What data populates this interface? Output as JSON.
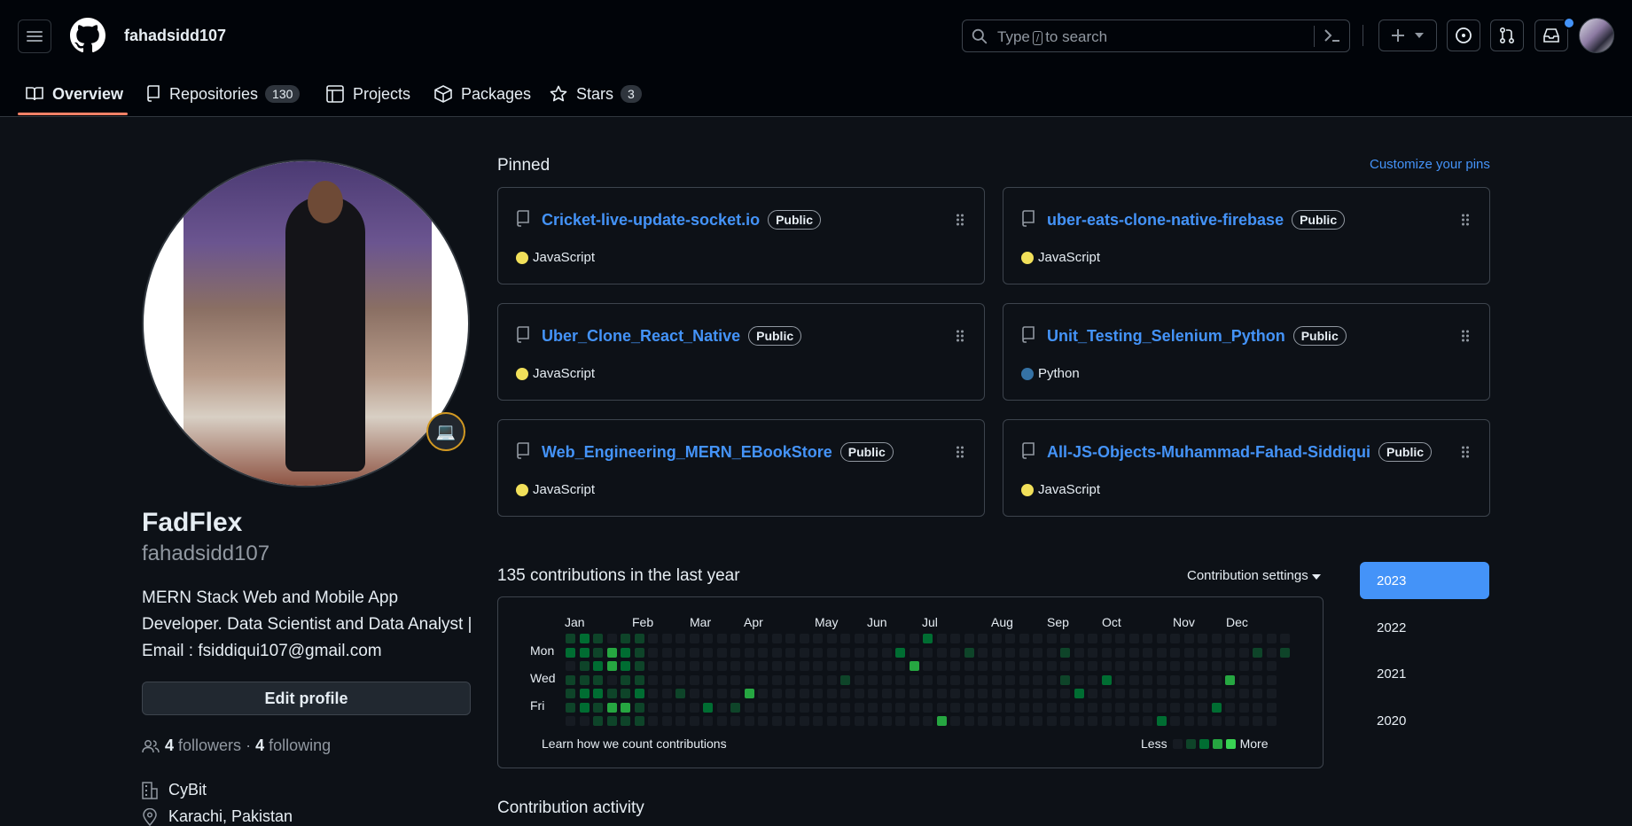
{
  "header": {
    "username": "fahadsidd107",
    "search_placeholder_before": "Type",
    "search_key": "/",
    "search_placeholder_after": "to search"
  },
  "tabs": [
    {
      "label": "Overview",
      "icon": "book-icon"
    },
    {
      "label": "Repositories",
      "count": "130",
      "icon": "repo-icon"
    },
    {
      "label": "Projects",
      "icon": "table-icon"
    },
    {
      "label": "Packages",
      "icon": "package-icon"
    },
    {
      "label": "Stars",
      "count": "3",
      "icon": "star-icon"
    }
  ],
  "profile": {
    "name": "FadFlex",
    "login": "fahadsidd107",
    "bio": "MERN Stack Web and Mobile App Developer. Data Scientist and Data Analyst | Email : fsiddiqui107@gmail.com",
    "edit_label": "Edit profile",
    "followers": "4",
    "followers_label": "followers",
    "following": "4",
    "following_label": "following",
    "separator": "·",
    "company": "CyBit",
    "location": "Karachi, Pakistan",
    "status_emoji": "💻"
  },
  "pinned": {
    "title": "Pinned",
    "customize": "Customize your pins",
    "repos": [
      {
        "name": "Cricket-live-update-socket.io",
        "visibility": "Public",
        "language": "JavaScript",
        "lang_color": "#f1e05a"
      },
      {
        "name": "uber-eats-clone-native-firebase",
        "visibility": "Public",
        "language": "JavaScript",
        "lang_color": "#f1e05a"
      },
      {
        "name": "Uber_Clone_React_Native",
        "visibility": "Public",
        "language": "JavaScript",
        "lang_color": "#f1e05a"
      },
      {
        "name": "Unit_Testing_Selenium_Python",
        "visibility": "Public",
        "language": "Python",
        "lang_color": "#3572A5"
      },
      {
        "name": "Web_Engineering_MERN_EBookStore",
        "visibility": "Public",
        "language": "JavaScript",
        "lang_color": "#f1e05a"
      },
      {
        "name": "All-JS-Objects-Muhammad-Fahad-Siddiqui",
        "visibility": "Public",
        "language": "JavaScript",
        "lang_color": "#f1e05a"
      }
    ]
  },
  "contributions": {
    "title": "135 contributions in the last year",
    "settings_label": "Contribution settings",
    "months": [
      "Jan",
      "Feb",
      "Mar",
      "Apr",
      "May",
      "Jun",
      "Jul",
      "Aug",
      "Sep",
      "Oct",
      "Nov",
      "Dec"
    ],
    "days": [
      "Mon",
      "Wed",
      "Fri"
    ],
    "learn_label": "Learn how we count contributions",
    "less_label": "Less",
    "more_label": "More",
    "level_colors": [
      "#161b22",
      "#0e4429",
      "#006d32",
      "#26a641",
      "#39d353"
    ]
  },
  "years": [
    "2023",
    "2022",
    "2021",
    "2020"
  ],
  "selected_year": "2023",
  "activity_title": "Contribution activity",
  "colors": {
    "accent": "#4493f8",
    "underline": "#f78166"
  }
}
